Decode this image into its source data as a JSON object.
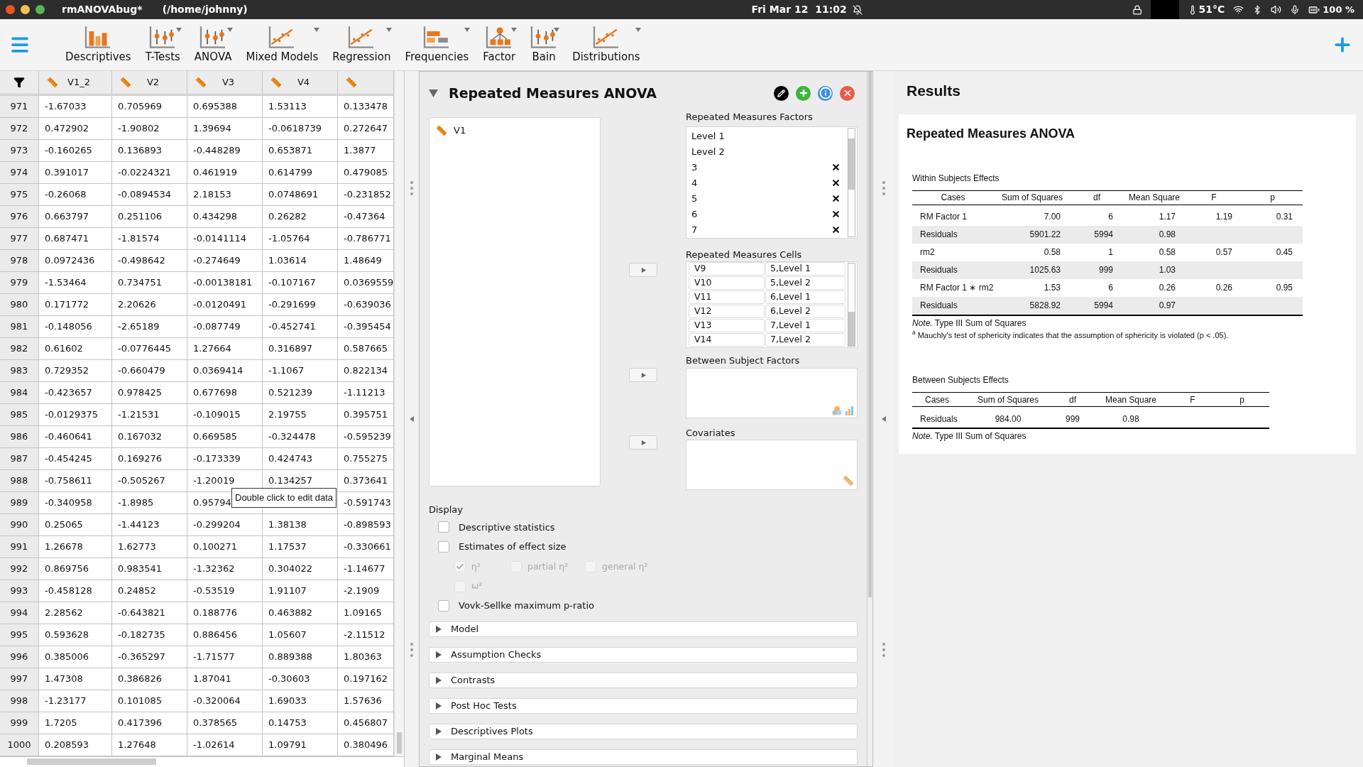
{
  "top_bar": {
    "app_title": "rmANOVAbug*",
    "path": "(/home/johnny)",
    "clock": "Fri Mar 12  11:02",
    "temperature": "51°C",
    "battery": "100 %"
  },
  "toolbar": {
    "items": [
      {
        "label": "Descriptives",
        "menu": false
      },
      {
        "label": "T-Tests",
        "menu": true
      },
      {
        "label": "ANOVA",
        "menu": true
      },
      {
        "label": "Mixed Models",
        "menu": true
      },
      {
        "label": "Regression",
        "menu": true
      },
      {
        "label": "Frequencies",
        "menu": true
      },
      {
        "label": "Factor",
        "menu": true
      },
      {
        "label": "Bain",
        "menu": true
      },
      {
        "label": "Distributions",
        "menu": true
      }
    ]
  },
  "data_table": {
    "columns": [
      "V1_2",
      "V2",
      "V3",
      "V4",
      null
    ],
    "rows": [
      {
        "n": "971",
        "cells": [
          "-1.67033",
          "0.705969",
          "0.695388",
          "1.53113",
          "0.133478"
        ]
      },
      {
        "n": "972",
        "cells": [
          "0.472902",
          "-1.90802",
          "1.39694",
          "-0.0618739",
          "0.272647"
        ]
      },
      {
        "n": "973",
        "cells": [
          "-0.160265",
          "0.136893",
          "-0.448289",
          "0.653871",
          "1.3877"
        ]
      },
      {
        "n": "974",
        "cells": [
          "0.391017",
          "-0.0224321",
          "0.461919",
          "0.614799",
          "0.479085"
        ]
      },
      {
        "n": "975",
        "cells": [
          "-0.26068",
          "-0.0894534",
          "2.18153",
          "0.0748691",
          "-0.231852"
        ]
      },
      {
        "n": "976",
        "cells": [
          "0.663797",
          "0.251106",
          "0.434298",
          "0.26282",
          "-0.47364"
        ]
      },
      {
        "n": "977",
        "cells": [
          "0.687471",
          "-1.81574",
          "-0.0141114",
          "-1.05764",
          "-0.786771"
        ]
      },
      {
        "n": "978",
        "cells": [
          "0.0972436",
          "-0.498642",
          "-0.274649",
          "1.03614",
          "1.48649"
        ]
      },
      {
        "n": "979",
        "cells": [
          "-1.53464",
          "0.734751",
          "-0.00138181",
          "-0.107167",
          "0.0369559"
        ]
      },
      {
        "n": "980",
        "cells": [
          "0.171772",
          "2.20626",
          "-0.0120491",
          "-0.291699",
          "-0.639036"
        ]
      },
      {
        "n": "981",
        "cells": [
          "-0.148056",
          "-2.65189",
          "-0.087749",
          "-0.452741",
          "-0.395454"
        ]
      },
      {
        "n": "982",
        "cells": [
          "0.61602",
          "-0.0776445",
          "1.27664",
          "0.316897",
          "0.587665"
        ]
      },
      {
        "n": "983",
        "cells": [
          "0.729352",
          "-0.660479",
          "0.0369414",
          "-1.1067",
          "0.822134"
        ]
      },
      {
        "n": "984",
        "cells": [
          "-0.423657",
          "0.978425",
          "0.677698",
          "0.521239",
          "-1.11213"
        ]
      },
      {
        "n": "985",
        "cells": [
          "-0.0129375",
          "-1.21531",
          "-0.109015",
          "2.19755",
          "0.395751"
        ]
      },
      {
        "n": "986",
        "cells": [
          "-0.460641",
          "0.167032",
          "0.669585",
          "-0.324478",
          "-0.595239"
        ]
      },
      {
        "n": "987",
        "cells": [
          "-0.454245",
          "0.169276",
          "-0.173339",
          "0.424743",
          "0.755275"
        ]
      },
      {
        "n": "988",
        "cells": [
          "-0.758611",
          "-0.505267",
          "-1.20019",
          "0.134257",
          "0.373641"
        ]
      },
      {
        "n": "989",
        "cells": [
          "-0.340958",
          "-1.8985",
          "0.95794",
          null,
          "-0.591743"
        ]
      },
      {
        "n": "990",
        "cells": [
          "0.25065",
          "-1.44123",
          "-0.299204",
          "1.38138",
          "-0.898593"
        ]
      },
      {
        "n": "991",
        "cells": [
          "1.26678",
          "1.62773",
          "0.100271",
          "1.17537",
          "-0.330661"
        ]
      },
      {
        "n": "992",
        "cells": [
          "0.869756",
          "0.983541",
          "-1.32362",
          "0.304022",
          "-1.14677"
        ]
      },
      {
        "n": "993",
        "cells": [
          "-0.458128",
          "0.24852",
          "-0.53519",
          "1.91107",
          "-2.1909"
        ]
      },
      {
        "n": "994",
        "cells": [
          "2.28562",
          "-0.643821",
          "0.188776",
          "0.463882",
          "1.09165"
        ]
      },
      {
        "n": "995",
        "cells": [
          "0.593628",
          "-0.182735",
          "0.886456",
          "1.05607",
          "-2.11512"
        ]
      },
      {
        "n": "996",
        "cells": [
          "0.385006",
          "-0.365297",
          "-1.71577",
          "0.889388",
          "1.80363"
        ]
      },
      {
        "n": "997",
        "cells": [
          "1.47308",
          "0.386826",
          "1.87041",
          "-0.30603",
          "0.197162"
        ]
      },
      {
        "n": "998",
        "cells": [
          "-1.23177",
          "0.101085",
          "-0.320064",
          "1.69033",
          "1.57636"
        ]
      },
      {
        "n": "999",
        "cells": [
          "1.7205",
          "0.417396",
          "0.378565",
          "0.14753",
          "0.456807"
        ]
      },
      {
        "n": "1000",
        "cells": [
          "0.208593",
          "1.27648",
          "-1.02614",
          "1.09791",
          "0.380496"
        ]
      }
    ],
    "tooltip": "Double click to edit data"
  },
  "analysis": {
    "title": "Repeated Measures ANOVA",
    "expanded": true,
    "available_variables": [
      "V1"
    ],
    "rm_factors_label": "Repeated Measures Factors",
    "rm_factors": [
      {
        "label": "Level 1",
        "removable": false
      },
      {
        "label": "Level 2",
        "removable": false
      },
      {
        "label": "3",
        "removable": true
      },
      {
        "label": "4",
        "removable": true
      },
      {
        "label": "5",
        "removable": true
      },
      {
        "label": "6",
        "removable": true
      },
      {
        "label": "7",
        "removable": true
      }
    ],
    "rm_cells_label": "Repeated Measures Cells",
    "rm_cells": [
      {
        "variable": "V9",
        "cell": "5,Level 1"
      },
      {
        "variable": "V10",
        "cell": "5,Level 2"
      },
      {
        "variable": "V11",
        "cell": "6,Level 1"
      },
      {
        "variable": "V12",
        "cell": "6,Level 2"
      },
      {
        "variable": "V13",
        "cell": "7,Level 1"
      },
      {
        "variable": "V14",
        "cell": "7,Level 2"
      }
    ],
    "between_label": "Between Subject Factors",
    "covariates_label": "Covariates",
    "display": {
      "label": "Display",
      "options": [
        {
          "label": "Descriptive statistics",
          "checked": false,
          "disabled": false
        },
        {
          "label": "Estimates of effect size",
          "checked": false,
          "disabled": false,
          "children": [
            {
              "label": "η²",
              "checked": true,
              "disabled": true
            },
            {
              "label": "partial η²",
              "checked": false,
              "disabled": true
            },
            {
              "label": "general η²",
              "checked": false,
              "disabled": true
            },
            {
              "label": "ω²",
              "checked": false,
              "disabled": true
            }
          ]
        },
        {
          "label": "Vovk-Sellke maximum p-ratio",
          "checked": false,
          "disabled": false
        }
      ]
    },
    "sections": [
      {
        "label": "Model",
        "expanded": false
      },
      {
        "label": "Assumption Checks",
        "expanded": false
      },
      {
        "label": "Contrasts",
        "expanded": false
      },
      {
        "label": "Post Hoc Tests",
        "expanded": false
      },
      {
        "label": "Descriptives Plots",
        "expanded": false
      },
      {
        "label": "Marginal Means",
        "expanded": false
      }
    ]
  },
  "results": {
    "title": "Results",
    "analysis_title": "Repeated Measures ANOVA",
    "tables": [
      {
        "title": "Within Subjects Effects",
        "columns": [
          "Cases",
          "Sum of Squares",
          "df",
          "Mean Square",
          "F",
          "p"
        ],
        "rows": [
          {
            "shaded": false,
            "cells": [
              "RM Factor 1",
              "7.00",
              "6",
              "1.17",
              "1.19",
              "0.31"
            ]
          },
          {
            "shaded": true,
            "cells": [
              "Residuals",
              "5901.22",
              "5994",
              "0.98",
              null,
              null
            ]
          },
          {
            "shaded": false,
            "cells": [
              "rm2",
              "0.58",
              "1",
              "0.58",
              "0.57",
              "0.45"
            ]
          },
          {
            "shaded": true,
            "cells": [
              "Residuals",
              "1025.63",
              "999",
              "1.03",
              null,
              null
            ]
          },
          {
            "shaded": false,
            "cells": [
              "RM Factor 1 ∗ rm2",
              "1.53",
              "6",
              "0.26",
              "0.26",
              "0.95"
            ]
          },
          {
            "shaded": true,
            "cells": [
              "Residuals",
              "5828.92",
              "5994",
              "0.97",
              null,
              null
            ]
          }
        ],
        "notes": [
          "*Note.* Type III Sum of Squares",
          "$^{a}$ Mauchly's test of sphericity indicates that the assumption of sphericity is violated (p < .05)."
        ]
      },
      {
        "title": "Between Subjects Effects",
        "columns": [
          "Cases",
          "Sum of Squares",
          "df",
          "Mean Square",
          "F",
          "p"
        ],
        "rows": [
          {
            "shaded": false,
            "cells": [
              "Residuals",
              "984.00",
              "999",
              "0.98",
              null,
              null
            ]
          }
        ],
        "notes": [
          "*Note.* Type III Sum of Squares"
        ]
      }
    ]
  }
}
